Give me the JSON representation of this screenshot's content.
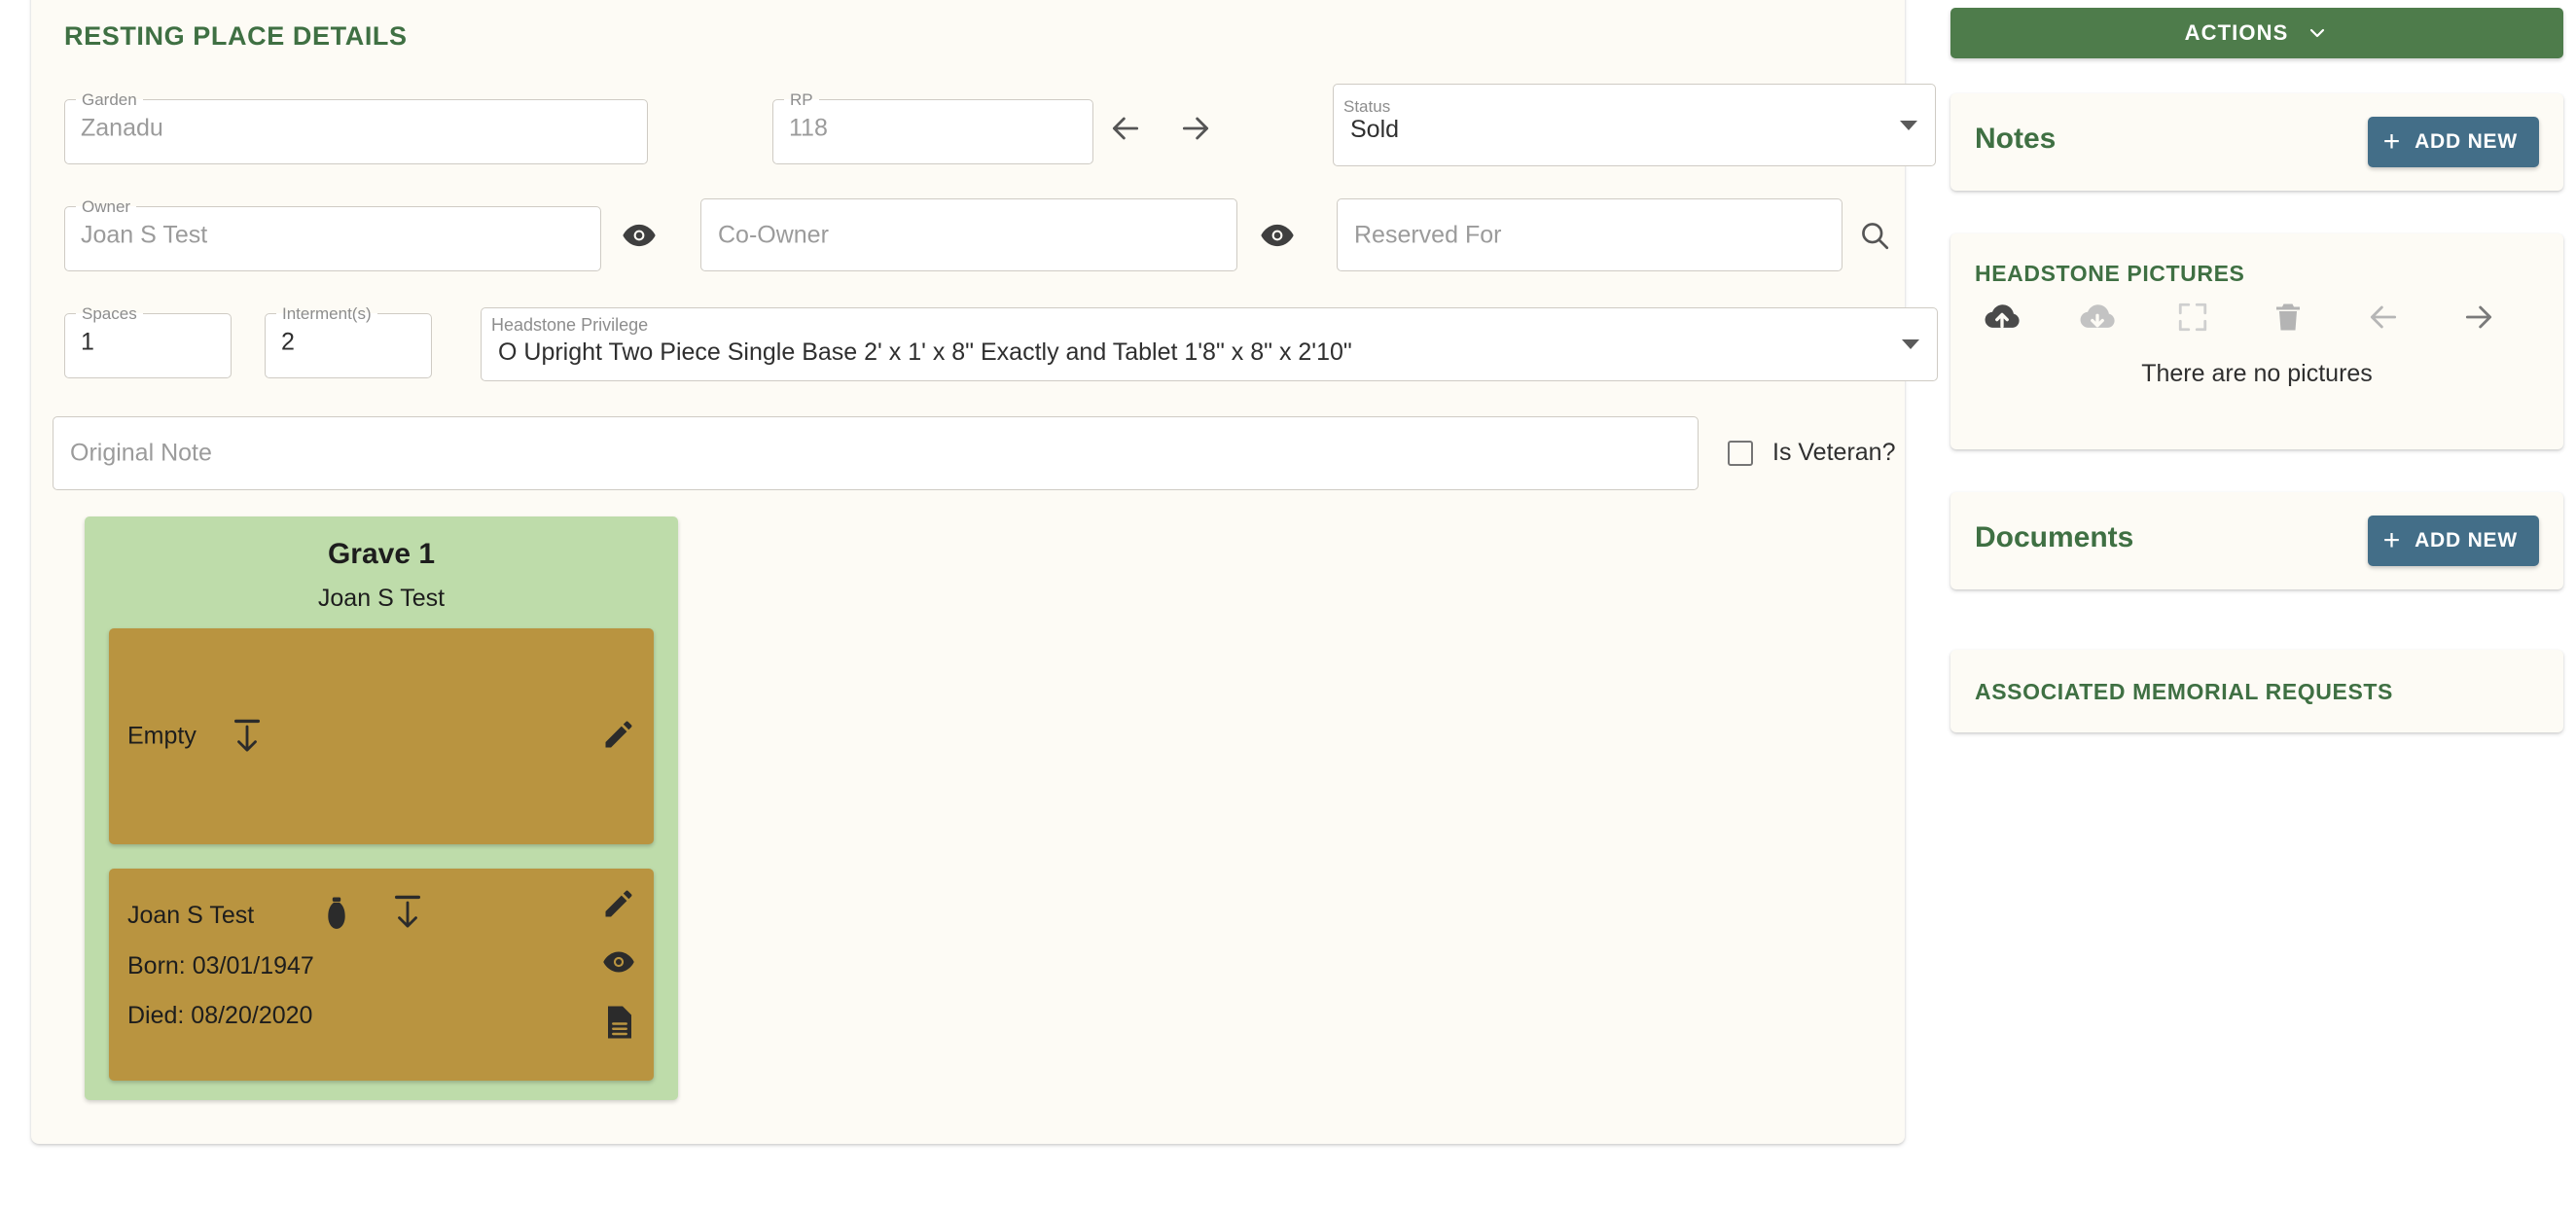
{
  "main": {
    "section_title": "RESTING PLACE DETAILS",
    "fields": {
      "garden": {
        "label": "Garden",
        "value": "Zanadu",
        "is_placeholder": true
      },
      "rp": {
        "label": "RP",
        "value": "118",
        "is_placeholder": true
      },
      "status": {
        "label": "Status",
        "value": "Sold"
      },
      "owner": {
        "label": "Owner",
        "value": "Joan S Test",
        "is_placeholder": true
      },
      "coowner": {
        "placeholder": "Co-Owner",
        "value": ""
      },
      "reserved": {
        "placeholder": "Reserved For",
        "value": ""
      },
      "spaces": {
        "label": "Spaces",
        "value": "1"
      },
      "interments": {
        "label": "Interment(s)",
        "value": "2"
      },
      "headstone_privilege": {
        "label": "Headstone Privilege",
        "value": "O Upright Two Piece Single Base 2' x 1' x 8\" Exactly and Tablet 1'8\" x 8\" x 2'10\""
      },
      "original_note": {
        "placeholder": "Original Note",
        "value": ""
      }
    },
    "nav": {
      "prev_icon": "arrow-left-icon",
      "next_icon": "arrow-right-icon"
    },
    "owner_reveal_icon": "eye-icon",
    "coowner_reveal_icon": "eye-icon",
    "reserved_search_icon": "search-icon",
    "veteran": {
      "label": "Is Veteran?",
      "checked": false
    }
  },
  "grave": {
    "title": "Grave 1",
    "subtitle": "Joan S Test",
    "slots": [
      {
        "name": "Empty",
        "icons": [
          "lower-casket-icon"
        ],
        "actions": [
          "edit-icon"
        ],
        "born": "",
        "died": ""
      },
      {
        "name": "Joan S Test",
        "icons": [
          "urn-icon",
          "lower-casket-icon"
        ],
        "actions": [
          "edit-icon",
          "eye-icon",
          "document-icon"
        ],
        "born": "Born: 03/01/1947",
        "died": "Died: 08/20/2020"
      }
    ]
  },
  "sidebar": {
    "actions_button": {
      "label": "ACTIONS",
      "icon": "chevron-down-icon"
    },
    "notes": {
      "title": "Notes",
      "add_label": "ADD NEW"
    },
    "headstone_pictures": {
      "title": "HEADSTONE PICTURES",
      "empty_text": "There are no pictures",
      "tools": [
        {
          "name": "cloud-upload-icon",
          "enabled": true
        },
        {
          "name": "cloud-download-icon",
          "enabled": false
        },
        {
          "name": "fullscreen-icon",
          "enabled": false
        },
        {
          "name": "trash-icon",
          "enabled": false
        },
        {
          "name": "arrow-left-icon",
          "enabled": false
        },
        {
          "name": "arrow-right-icon",
          "enabled": true
        }
      ]
    },
    "documents": {
      "title": "Documents",
      "add_label": "ADD NEW"
    },
    "memorial_requests": {
      "title": "ASSOCIATED MEMORIAL REQUESTS"
    }
  },
  "colors": {
    "accent_green": "#3f7043",
    "actions_green": "#4e7c4b",
    "add_blue": "#436e88",
    "grave_green": "#bedcaa",
    "slot_gold": "#b99440",
    "card_bg": "#fdfbf5"
  }
}
